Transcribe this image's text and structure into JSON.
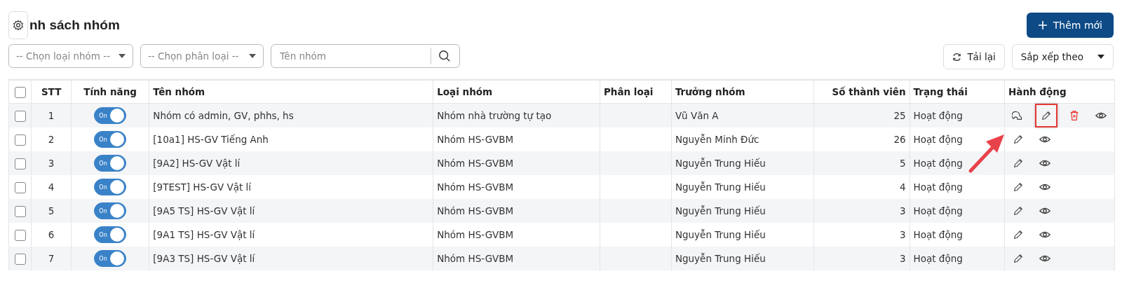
{
  "title": "nh sách nhóm",
  "add_button": "Thêm mới",
  "filters": [
    {
      "kind": "select",
      "placeholder": "-- Chọn loại nhóm --"
    },
    {
      "kind": "select",
      "placeholder": "-- Chọn phân loại --"
    },
    {
      "kind": "search",
      "placeholder": "Tên nhóm"
    }
  ],
  "reload_button": "Tải lại",
  "sort_button": "Sắp xếp theo",
  "table": {
    "all_checked": false,
    "columns": [
      "STT",
      "Tính năng",
      "Tên nhóm",
      "Loại nhóm",
      "Phân loại",
      "Trưởng nhóm",
      "Số thành viên",
      "Trạng thái",
      "Hành động"
    ],
    "rows": [
      {
        "checked": false,
        "stt": "1",
        "feature": {
          "on": true,
          "label": "On"
        },
        "name": "Nhóm có admin, GV, phhs, hs",
        "type": "Nhóm nhà trường tự tạo",
        "category": "",
        "leader": "Vũ Văn A",
        "members": "25",
        "status": "Hoạt động",
        "actions": [
          {
            "kind": "share",
            "highlighted": false
          },
          {
            "kind": "edit",
            "highlighted": true
          },
          {
            "kind": "delete",
            "highlighted": false
          },
          {
            "kind": "view",
            "highlighted": false
          }
        ]
      },
      {
        "checked": false,
        "stt": "2",
        "feature": {
          "on": true,
          "label": "On"
        },
        "name": "[10a1] HS-GV Tiếng Anh",
        "type": "Nhóm HS-GVBM",
        "category": "",
        "leader": "Nguyễn Minh Đức",
        "members": "26",
        "status": "Hoạt động",
        "actions": [
          {
            "kind": "edit",
            "highlighted": false
          },
          {
            "kind": "view",
            "highlighted": false
          }
        ]
      },
      {
        "checked": false,
        "stt": "3",
        "feature": {
          "on": true,
          "label": "On"
        },
        "name": "[9A2] HS-GV Vật lí",
        "type": "Nhóm HS-GVBM",
        "category": "",
        "leader": "Nguyễn Trung Hiếu",
        "members": "5",
        "status": "Hoạt động",
        "actions": [
          {
            "kind": "edit",
            "highlighted": false
          },
          {
            "kind": "view",
            "highlighted": false
          }
        ]
      },
      {
        "checked": false,
        "stt": "4",
        "feature": {
          "on": true,
          "label": "On"
        },
        "name": "[9TEST] HS-GV Vật lí",
        "type": "Nhóm HS-GVBM",
        "category": "",
        "leader": "Nguyễn Trung Hiếu",
        "members": "4",
        "status": "Hoạt động",
        "actions": [
          {
            "kind": "edit",
            "highlighted": false
          },
          {
            "kind": "view",
            "highlighted": false
          }
        ]
      },
      {
        "checked": false,
        "stt": "5",
        "feature": {
          "on": true,
          "label": "On"
        },
        "name": "[9A5 TS] HS-GV Vật lí",
        "type": "Nhóm HS-GVBM",
        "category": "",
        "leader": "Nguyễn Trung Hiếu",
        "members": "3",
        "status": "Hoạt động",
        "actions": [
          {
            "kind": "edit",
            "highlighted": false
          },
          {
            "kind": "view",
            "highlighted": false
          }
        ]
      },
      {
        "checked": false,
        "stt": "6",
        "feature": {
          "on": true,
          "label": "On"
        },
        "name": "[9A1 TS] HS-GV Vật lí",
        "type": "Nhóm HS-GVBM",
        "category": "",
        "leader": "Nguyễn Trung Hiếu",
        "members": "3",
        "status": "Hoạt động",
        "actions": [
          {
            "kind": "edit",
            "highlighted": false
          },
          {
            "kind": "view",
            "highlighted": false
          }
        ]
      },
      {
        "checked": false,
        "stt": "7",
        "feature": {
          "on": true,
          "label": "On"
        },
        "name": "[9A3 TS] HS-GV Vật lí",
        "type": "Nhóm HS-GVBM",
        "category": "",
        "leader": "Nguyễn Trung Hiếu",
        "members": "3",
        "status": "Hoạt động",
        "actions": [
          {
            "kind": "edit",
            "highlighted": false
          },
          {
            "kind": "view",
            "highlighted": false
          }
        ]
      }
    ]
  }
}
